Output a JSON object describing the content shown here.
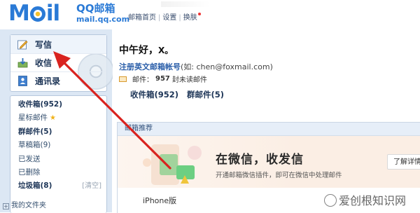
{
  "header": {
    "logo_text_a": "M",
    "logo_text_b": "il",
    "brand_cn": "QQ邮箱",
    "brand_en": "mail.qq.com",
    "nav": [
      "邮箱首页",
      "设置",
      "换肤"
    ],
    "nav_sep": "|"
  },
  "sidebar": {
    "actions": [
      {
        "label": "写信",
        "icon": "pencil-icon"
      },
      {
        "label": "收信",
        "icon": "inbox-icon"
      },
      {
        "label": "通讯录",
        "icon": "contacts-icon"
      }
    ],
    "folders": [
      {
        "label": "收件箱(952)",
        "bold": true
      },
      {
        "label": "星标邮件",
        "bold": false,
        "star": "★"
      },
      {
        "label": "群邮件(5)",
        "bold": true
      },
      {
        "label": "草稿箱(9)",
        "bold": false
      },
      {
        "label": "已发送",
        "bold": false
      },
      {
        "label": "已删除",
        "bold": false
      },
      {
        "label": "垃圾箱(8)",
        "bold": true,
        "extra": "[清空]"
      }
    ],
    "my_folders": "我的文件夹",
    "my_folders_toggle": "+"
  },
  "main": {
    "greeting": "中午好，",
    "greeting_name": "X。",
    "register_label": "注册英文邮箱帐号",
    "register_hint": "(如: chen@foxmail.com)",
    "mail_prefix": "邮件：",
    "mail_count": "957",
    "mail_suffix": "封未读邮件",
    "links": [
      "收件箱(952)",
      "群邮件(5)"
    ],
    "recommend": {
      "header": "邮箱推荐",
      "banner_title": "在微信，收发信",
      "banner_sub": "开通邮箱微信插件，即可在微信中处理邮件",
      "banner_button": "了解详情",
      "app_label": "iPhone版"
    }
  },
  "watermark": "爱创根知识网",
  "colors": {
    "brand_blue": "#2a7ad6",
    "sidebar_bg": "#dce7f4",
    "arrow_red": "#d9231f"
  }
}
